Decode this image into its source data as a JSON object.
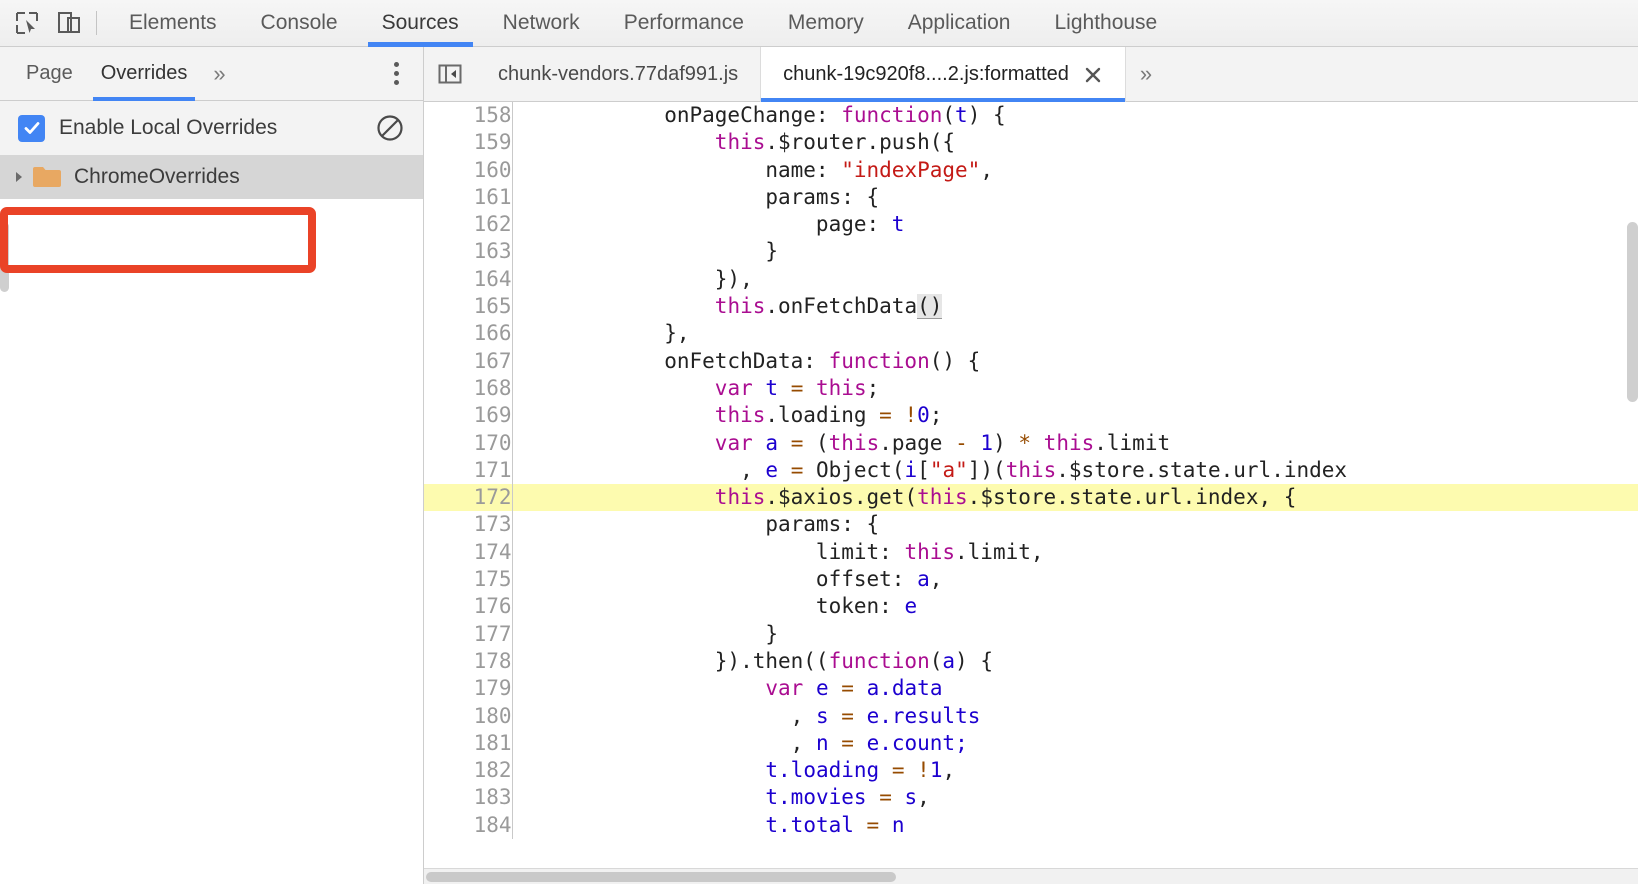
{
  "main_toolbar": {
    "inspect_icon": "inspect-element-icon",
    "device_icon": "device-toolbar-icon",
    "tabs": [
      {
        "label": "Elements",
        "active": false
      },
      {
        "label": "Console",
        "active": false
      },
      {
        "label": "Sources",
        "active": true
      },
      {
        "label": "Network",
        "active": false
      },
      {
        "label": "Performance",
        "active": false
      },
      {
        "label": "Memory",
        "active": false
      },
      {
        "label": "Application",
        "active": false
      },
      {
        "label": "Lighthouse",
        "active": false
      }
    ]
  },
  "navigator": {
    "tabs": [
      {
        "label": "Page",
        "active": false
      },
      {
        "label": "Overrides",
        "active": true
      }
    ],
    "more_label": "»",
    "menu_icon": "more-options-icon",
    "overrides": {
      "checkbox_label": "Enable Local Overrides",
      "checkbox_checked": true,
      "clear_icon": "clear-configuration-icon"
    },
    "tree": [
      {
        "label": "ChromeOverrides",
        "icon": "folder-icon",
        "expanded": false,
        "selected": true
      }
    ]
  },
  "annotation": {
    "color": "#ea4327",
    "target": "ChromeOverrides"
  },
  "editor": {
    "nav_back_icon": "show-navigator-icon",
    "tabs": [
      {
        "label": "chunk-vendors.77daf991.js",
        "active": false,
        "closable": false
      },
      {
        "label": "chunk-19c920f8....2.js:formatted",
        "active": true,
        "closable": true
      }
    ],
    "close_icon": "close-icon",
    "more_label": "»",
    "highlighted_line": 172,
    "lines": [
      {
        "n": "158",
        "tokens": [
          {
            "t": "            onPageChange: ",
            "c": "pl"
          },
          {
            "t": "function",
            "c": "kw"
          },
          {
            "t": "(",
            "c": "pl"
          },
          {
            "t": "t",
            "c": "var"
          },
          {
            "t": ") {",
            "c": "pl"
          }
        ]
      },
      {
        "n": "159",
        "tokens": [
          {
            "t": "                ",
            "c": "pl"
          },
          {
            "t": "this",
            "c": "kw"
          },
          {
            "t": ".$router.push({",
            "c": "pl"
          }
        ]
      },
      {
        "n": "160",
        "tokens": [
          {
            "t": "                    name: ",
            "c": "pl"
          },
          {
            "t": "\"indexPage\"",
            "c": "str"
          },
          {
            "t": ",",
            "c": "pl"
          }
        ]
      },
      {
        "n": "161",
        "tokens": [
          {
            "t": "                    params: {",
            "c": "pl"
          }
        ]
      },
      {
        "n": "162",
        "tokens": [
          {
            "t": "                        page: ",
            "c": "pl"
          },
          {
            "t": "t",
            "c": "var"
          }
        ]
      },
      {
        "n": "163",
        "tokens": [
          {
            "t": "                    }",
            "c": "pl"
          }
        ]
      },
      {
        "n": "164",
        "tokens": [
          {
            "t": "                }),",
            "c": "pl"
          }
        ]
      },
      {
        "n": "165",
        "tokens": [
          {
            "t": "                ",
            "c": "pl"
          },
          {
            "t": "this",
            "c": "kw"
          },
          {
            "t": ".onFetchData",
            "c": "pl"
          },
          {
            "t": "()",
            "c": "hit"
          }
        ]
      },
      {
        "n": "166",
        "tokens": [
          {
            "t": "            },",
            "c": "pl"
          }
        ]
      },
      {
        "n": "167",
        "tokens": [
          {
            "t": "            onFetchData: ",
            "c": "pl"
          },
          {
            "t": "function",
            "c": "kw"
          },
          {
            "t": "() {",
            "c": "pl"
          }
        ]
      },
      {
        "n": "168",
        "tokens": [
          {
            "t": "                ",
            "c": "pl"
          },
          {
            "t": "var",
            "c": "kw"
          },
          {
            "t": " ",
            "c": "pl"
          },
          {
            "t": "t",
            "c": "var"
          },
          {
            "t": " ",
            "c": "pl"
          },
          {
            "t": "=",
            "c": "op"
          },
          {
            "t": " ",
            "c": "pl"
          },
          {
            "t": "this",
            "c": "kw"
          },
          {
            "t": ";",
            "c": "pl"
          }
        ]
      },
      {
        "n": "169",
        "tokens": [
          {
            "t": "                ",
            "c": "pl"
          },
          {
            "t": "this",
            "c": "kw"
          },
          {
            "t": ".loading ",
            "c": "pl"
          },
          {
            "t": "=",
            "c": "op"
          },
          {
            "t": " ",
            "c": "pl"
          },
          {
            "t": "!",
            "c": "op"
          },
          {
            "t": "0",
            "c": "num"
          },
          {
            "t": ";",
            "c": "pl"
          }
        ]
      },
      {
        "n": "170",
        "tokens": [
          {
            "t": "                ",
            "c": "pl"
          },
          {
            "t": "var",
            "c": "kw"
          },
          {
            "t": " ",
            "c": "pl"
          },
          {
            "t": "a",
            "c": "var"
          },
          {
            "t": " ",
            "c": "pl"
          },
          {
            "t": "=",
            "c": "op"
          },
          {
            "t": " (",
            "c": "pl"
          },
          {
            "t": "this",
            "c": "kw"
          },
          {
            "t": ".page ",
            "c": "pl"
          },
          {
            "t": "-",
            "c": "op"
          },
          {
            "t": " ",
            "c": "pl"
          },
          {
            "t": "1",
            "c": "num"
          },
          {
            "t": ") ",
            "c": "pl"
          },
          {
            "t": "*",
            "c": "op"
          },
          {
            "t": " ",
            "c": "pl"
          },
          {
            "t": "this",
            "c": "kw"
          },
          {
            "t": ".limit",
            "c": "pl"
          }
        ]
      },
      {
        "n": "171",
        "tokens": [
          {
            "t": "                  , ",
            "c": "pl"
          },
          {
            "t": "e",
            "c": "var"
          },
          {
            "t": " ",
            "c": "pl"
          },
          {
            "t": "=",
            "c": "op"
          },
          {
            "t": " Object(",
            "c": "pl"
          },
          {
            "t": "i",
            "c": "var"
          },
          {
            "t": "[",
            "c": "pl"
          },
          {
            "t": "\"a\"",
            "c": "str"
          },
          {
            "t": "])(",
            "c": "pl"
          },
          {
            "t": "this",
            "c": "kw"
          },
          {
            "t": ".$store.state.url.index",
            "c": "pl"
          }
        ]
      },
      {
        "n": "172",
        "tokens": [
          {
            "t": "                ",
            "c": "pl"
          },
          {
            "t": "this",
            "c": "kw"
          },
          {
            "t": ".$axios.get(",
            "c": "pl"
          },
          {
            "t": "this",
            "c": "kw"
          },
          {
            "t": ".$store.state.url.index, {",
            "c": "pl"
          }
        ]
      },
      {
        "n": "173",
        "tokens": [
          {
            "t": "                    params: {",
            "c": "pl"
          }
        ]
      },
      {
        "n": "174",
        "tokens": [
          {
            "t": "                        limit: ",
            "c": "pl"
          },
          {
            "t": "this",
            "c": "kw"
          },
          {
            "t": ".limit,",
            "c": "pl"
          }
        ]
      },
      {
        "n": "175",
        "tokens": [
          {
            "t": "                        offset: ",
            "c": "pl"
          },
          {
            "t": "a",
            "c": "var"
          },
          {
            "t": ",",
            "c": "pl"
          }
        ]
      },
      {
        "n": "176",
        "tokens": [
          {
            "t": "                        token: ",
            "c": "pl"
          },
          {
            "t": "e",
            "c": "var"
          }
        ]
      },
      {
        "n": "177",
        "tokens": [
          {
            "t": "                    }",
            "c": "pl"
          }
        ]
      },
      {
        "n": "178",
        "tokens": [
          {
            "t": "                }).then((",
            "c": "pl"
          },
          {
            "t": "function",
            "c": "kw"
          },
          {
            "t": "(",
            "c": "pl"
          },
          {
            "t": "a",
            "c": "var"
          },
          {
            "t": ") {",
            "c": "pl"
          }
        ]
      },
      {
        "n": "179",
        "tokens": [
          {
            "t": "                    ",
            "c": "pl"
          },
          {
            "t": "var",
            "c": "kw"
          },
          {
            "t": " ",
            "c": "pl"
          },
          {
            "t": "e",
            "c": "var"
          },
          {
            "t": " ",
            "c": "pl"
          },
          {
            "t": "=",
            "c": "op"
          },
          {
            "t": " ",
            "c": "pl"
          },
          {
            "t": "a",
            "c": "var"
          },
          {
            "t": ".data",
            "c": "var"
          }
        ]
      },
      {
        "n": "180",
        "tokens": [
          {
            "t": "                      , ",
            "c": "pl"
          },
          {
            "t": "s",
            "c": "var"
          },
          {
            "t": " ",
            "c": "pl"
          },
          {
            "t": "=",
            "c": "op"
          },
          {
            "t": " ",
            "c": "pl"
          },
          {
            "t": "e",
            "c": "var"
          },
          {
            "t": ".results",
            "c": "var"
          }
        ]
      },
      {
        "n": "181",
        "tokens": [
          {
            "t": "                      , ",
            "c": "pl"
          },
          {
            "t": "n",
            "c": "var"
          },
          {
            "t": " ",
            "c": "pl"
          },
          {
            "t": "=",
            "c": "op"
          },
          {
            "t": " ",
            "c": "pl"
          },
          {
            "t": "e",
            "c": "var"
          },
          {
            "t": ".count;",
            "c": "var"
          }
        ]
      },
      {
        "n": "182",
        "tokens": [
          {
            "t": "                    ",
            "c": "pl"
          },
          {
            "t": "t",
            "c": "var"
          },
          {
            "t": ".loading",
            "c": "var"
          },
          {
            "t": " ",
            "c": "pl"
          },
          {
            "t": "=",
            "c": "op"
          },
          {
            "t": " ",
            "c": "pl"
          },
          {
            "t": "!",
            "c": "op"
          },
          {
            "t": "1",
            "c": "num"
          },
          {
            "t": ",",
            "c": "pl"
          }
        ]
      },
      {
        "n": "183",
        "tokens": [
          {
            "t": "                    ",
            "c": "pl"
          },
          {
            "t": "t",
            "c": "var"
          },
          {
            "t": ".movies",
            "c": "var"
          },
          {
            "t": " ",
            "c": "pl"
          },
          {
            "t": "=",
            "c": "op"
          },
          {
            "t": " ",
            "c": "pl"
          },
          {
            "t": "s",
            "c": "var"
          },
          {
            "t": ",",
            "c": "pl"
          }
        ]
      },
      {
        "n": "184",
        "tokens": [
          {
            "t": "                    ",
            "c": "pl"
          },
          {
            "t": "t",
            "c": "var"
          },
          {
            "t": ".total",
            "c": "var"
          },
          {
            "t": " ",
            "c": "pl"
          },
          {
            "t": "=",
            "c": "op"
          },
          {
            "t": " ",
            "c": "pl"
          },
          {
            "t": "n",
            "c": "var"
          }
        ]
      }
    ]
  },
  "colors": {
    "accent": "#4285f4",
    "annotation": "#ea4327",
    "highlight_line": "#fdfbaf",
    "folder": "#e8a862"
  }
}
